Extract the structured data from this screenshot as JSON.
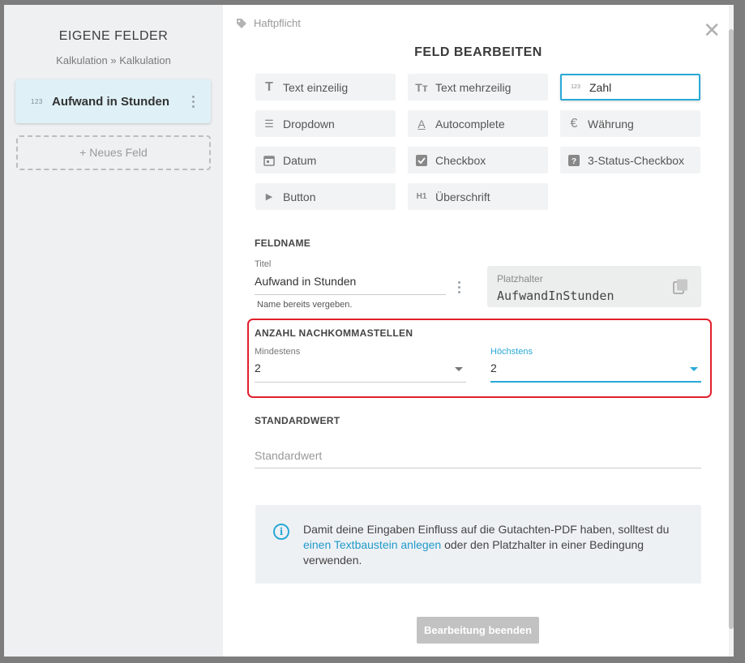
{
  "left_panel": {
    "title": "EIGENE FELDER",
    "breadcrumb": "Kalkulation » Kalkulation",
    "fields": [
      {
        "icon": "number-icon",
        "icon_text": "123",
        "label": "Aufwand in Stunden"
      }
    ],
    "new_field_label": "+ Neues Feld"
  },
  "right_panel": {
    "breadcrumb": "Haftpflicht",
    "heading": "FELD BEARBEITEN",
    "field_types": [
      {
        "label": "Text einzeilig",
        "icon": "text-single-icon",
        "active": false
      },
      {
        "label": "Text mehrzeilig",
        "icon": "text-multi-icon",
        "active": false
      },
      {
        "label": "Zahl",
        "icon": "number-icon",
        "icon_text": "123",
        "active": true
      },
      {
        "label": "Dropdown",
        "icon": "list-icon",
        "active": false
      },
      {
        "label": "Autocomplete",
        "icon": "autocomplete-icon",
        "active": false
      },
      {
        "label": "Währung",
        "icon": "euro-icon",
        "active": false
      },
      {
        "label": "Datum",
        "icon": "calendar-icon",
        "active": false
      },
      {
        "label": "Checkbox",
        "icon": "checkbox-icon",
        "active": false
      },
      {
        "label": "3-Status-Checkbox",
        "icon": "question-checkbox-icon",
        "active": false
      },
      {
        "label": "Button",
        "icon": "play-icon",
        "active": false
      },
      {
        "label": "Überschrift",
        "icon": "heading-icon",
        "icon_text": "H1",
        "active": false
      }
    ],
    "fieldname": {
      "section": "FELDNAME",
      "title_label": "Titel",
      "title_value": "Aufwand in Stunden",
      "hint": "Name bereits vergeben.",
      "placeholder_label": "Platzhalter",
      "placeholder_value": "AufwandInStunden"
    },
    "decimals": {
      "section": "ANZAHL NACHKOMMASTELLEN",
      "min_label": "Mindestens",
      "min_value": "2",
      "max_label": "Höchstens",
      "max_value": "2"
    },
    "default": {
      "section": "STANDARDWERT",
      "placeholder": "Standardwert"
    },
    "info": {
      "text_before": "Damit deine Eingaben Einfluss auf die Gutachten-PDF haben, solltest du",
      "link": "einen Textbaustein anlegen",
      "text_after": "oder den Platzhalter in einer Bedingung verwenden."
    },
    "finish_button": "Bearbeitung beenden"
  },
  "colors": {
    "accent": "#29a9d6",
    "highlight": "#e0202c",
    "selected_card": "#dff1f7",
    "disabled_button": "#c2c2c2"
  }
}
